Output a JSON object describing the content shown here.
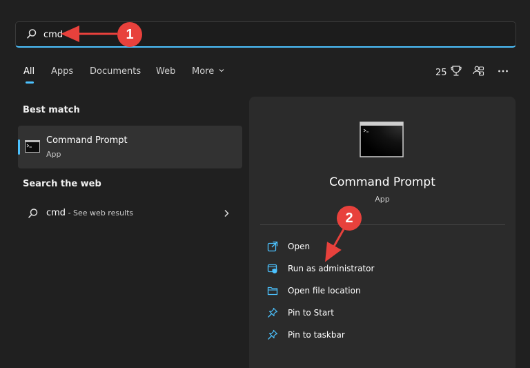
{
  "search": {
    "value": "cmd"
  },
  "tabs": [
    {
      "label": "All"
    },
    {
      "label": "Apps"
    },
    {
      "label": "Documents"
    },
    {
      "label": "Web"
    },
    {
      "label": "More"
    }
  ],
  "toolbar": {
    "points": "25"
  },
  "best_match": {
    "heading": "Best match",
    "title": "Command Prompt",
    "subtitle": "App"
  },
  "web": {
    "heading": "Search the web",
    "query": "cmd",
    "suffix": " - See web results"
  },
  "detail": {
    "title": "Command Prompt",
    "subtitle": "App",
    "actions": [
      {
        "label": "Open",
        "icon": "open-icon"
      },
      {
        "label": "Run as administrator",
        "icon": "shield-icon"
      },
      {
        "label": "Open file location",
        "icon": "folder-icon"
      },
      {
        "label": "Pin to Start",
        "icon": "pin-icon"
      },
      {
        "label": "Pin to taskbar",
        "icon": "pin-icon"
      }
    ]
  },
  "annotations": {
    "step1": "1",
    "step2": "2"
  },
  "colors": {
    "accent": "#4cc2ff",
    "callout": "#e8413c",
    "background": "#202020",
    "panel": "#2b2b2b"
  }
}
